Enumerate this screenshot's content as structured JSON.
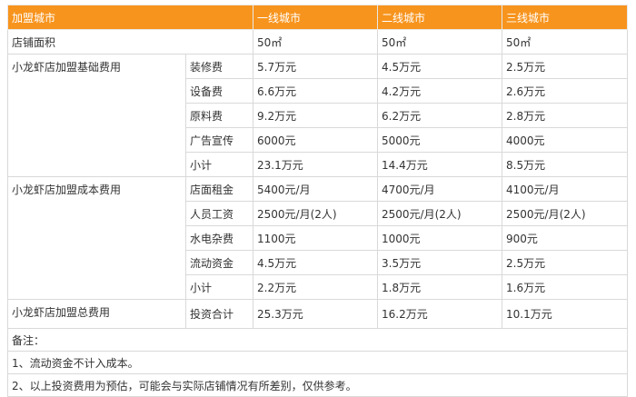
{
  "colors": {
    "header_bg": "#f7941d",
    "header_text": "#ffffff",
    "border": "#d9d9d9"
  },
  "headers": [
    "加盟城市",
    "一线城市",
    "二线城市",
    "三线城市"
  ],
  "area": {
    "label": "店铺面积",
    "values": [
      "50㎡",
      "50㎡",
      "50㎡"
    ]
  },
  "groups": [
    {
      "name": "小龙虾店加盟基础费用",
      "rows": [
        {
          "item": "装修费",
          "values": [
            "5.7万元",
            "4.5万元",
            "2.5万元"
          ]
        },
        {
          "item": "设备费",
          "values": [
            "6.6万元",
            "4.2万元",
            "2.6万元"
          ]
        },
        {
          "item": "原料费",
          "values": [
            "9.2万元",
            "6.2万元",
            "2.8万元"
          ]
        },
        {
          "item": "广告宣传",
          "values": [
            "6000元",
            "5000元",
            "4000元"
          ]
        },
        {
          "item": "小计",
          "values": [
            "23.1万元",
            "14.4万元",
            "8.5万元"
          ]
        }
      ]
    },
    {
      "name": "小龙虾店加盟成本费用",
      "rows": [
        {
          "item": "店面租金",
          "values": [
            "5400元/月",
            "4700元/月",
            "4100元/月"
          ]
        },
        {
          "item": "人员工资",
          "values": [
            "2500元/月(2人)",
            "2500元/月(2人)",
            "2500元/月(2人)"
          ]
        },
        {
          "item": "水电杂费",
          "values": [
            "1100元",
            "1000元",
            "900元"
          ]
        },
        {
          "item": "流动资金",
          "values": [
            "4.5万元",
            "3.5万元",
            "2.5万元"
          ]
        },
        {
          "item": "小计",
          "values": [
            "2.2万元",
            "1.8万元",
            "1.6万元"
          ]
        }
      ]
    },
    {
      "name": "小龙虾店加盟总费用",
      "rows": [
        {
          "item": "投资合计",
          "values": [
            "25.3万元",
            "16.2万元",
            "10.1万元"
          ]
        }
      ]
    }
  ],
  "notes": [
    "备注：",
    "1、流动资金不计入成本。",
    "2、以上投资费用为预估，可能会与实际店铺情况有所差别，仅供参考。"
  ]
}
